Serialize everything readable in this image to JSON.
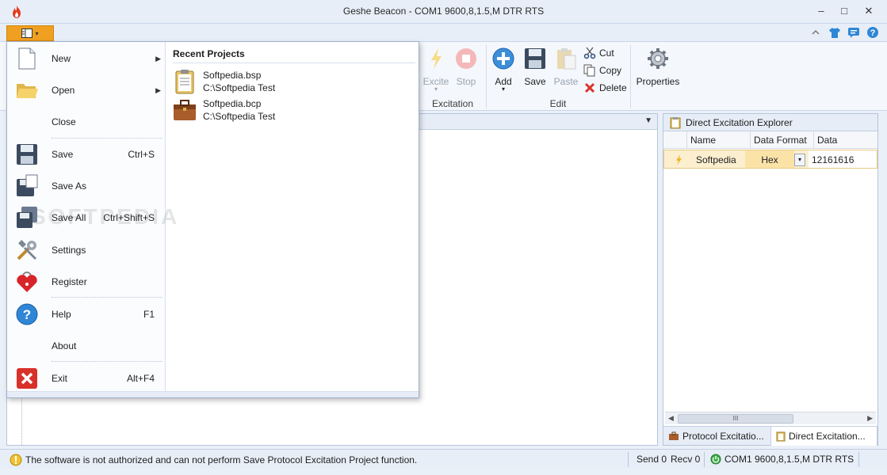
{
  "window": {
    "title": "Geshe Beacon - COM1  9600,8,1.5,M  DTR  RTS",
    "app_icon": "flame-icon",
    "minimize": "–",
    "maximize": "□",
    "close": "✕"
  },
  "ribbon": {
    "file_tab_icon": "menu-icon",
    "tab_icons": [
      "up-icon",
      "shirt-icon",
      "chat-icon",
      "help-icon"
    ],
    "excitation": {
      "label": "Excitation",
      "excite": "Excite",
      "stop": "Stop"
    },
    "edit": {
      "label": "Edit",
      "add": "Add",
      "save": "Save",
      "paste": "Paste",
      "cut": "Cut",
      "copy": "Copy",
      "delete": "Delete"
    },
    "properties": "Properties"
  },
  "menu": {
    "items": [
      {
        "label": "New",
        "shortcut": "",
        "icon": "new-file-icon"
      },
      {
        "label": "Open",
        "shortcut": "",
        "icon": "folder-icon"
      },
      {
        "label": "Close",
        "shortcut": "",
        "icon": ""
      },
      {
        "label": "Save",
        "shortcut": "Ctrl+S",
        "icon": "floppy-icon"
      },
      {
        "label": "Save As",
        "shortcut": "",
        "icon": "floppy-as-icon"
      },
      {
        "label": "Save All",
        "shortcut": "Ctrl+Shift+S",
        "icon": "floppy-all-icon"
      },
      {
        "label": "Settings",
        "shortcut": "",
        "icon": "tools-icon"
      },
      {
        "label": "Register",
        "shortcut": "",
        "icon": "heart-lock-icon"
      },
      {
        "label": "Help",
        "shortcut": "F1",
        "icon": "help-icon"
      },
      {
        "label": "About",
        "shortcut": "",
        "icon": ""
      },
      {
        "label": "Exit",
        "shortcut": "Alt+F4",
        "icon": "exit-icon"
      }
    ],
    "recent_title": "Recent Projects",
    "recent": [
      {
        "name": "Softpedia.bsp",
        "path": "C:\\Softpedia Test",
        "icon": "clipboard-icon"
      },
      {
        "name": "Softpedia.bcp",
        "path": "C:\\Softpedia Test",
        "icon": "briefcase-icon"
      }
    ],
    "watermark": "SOFTPEDIA"
  },
  "panel": {
    "title": "Direct Excitation Explorer",
    "columns": [
      "Name",
      "Data Format",
      "Data"
    ],
    "row": {
      "name": "Softpedia",
      "format": "Hex",
      "data": "12161616"
    },
    "tabs": [
      "Protocol Excitatio...",
      "Direct Excitation..."
    ],
    "scroll_thumb": "III"
  },
  "status": {
    "message": "The software is not authorized and can not perform Save Protocol Excitation Project function.",
    "send": "Send 0",
    "recv": "Recv 0",
    "port": "COM1  9600,8,1.5,M  DTR  RTS"
  }
}
